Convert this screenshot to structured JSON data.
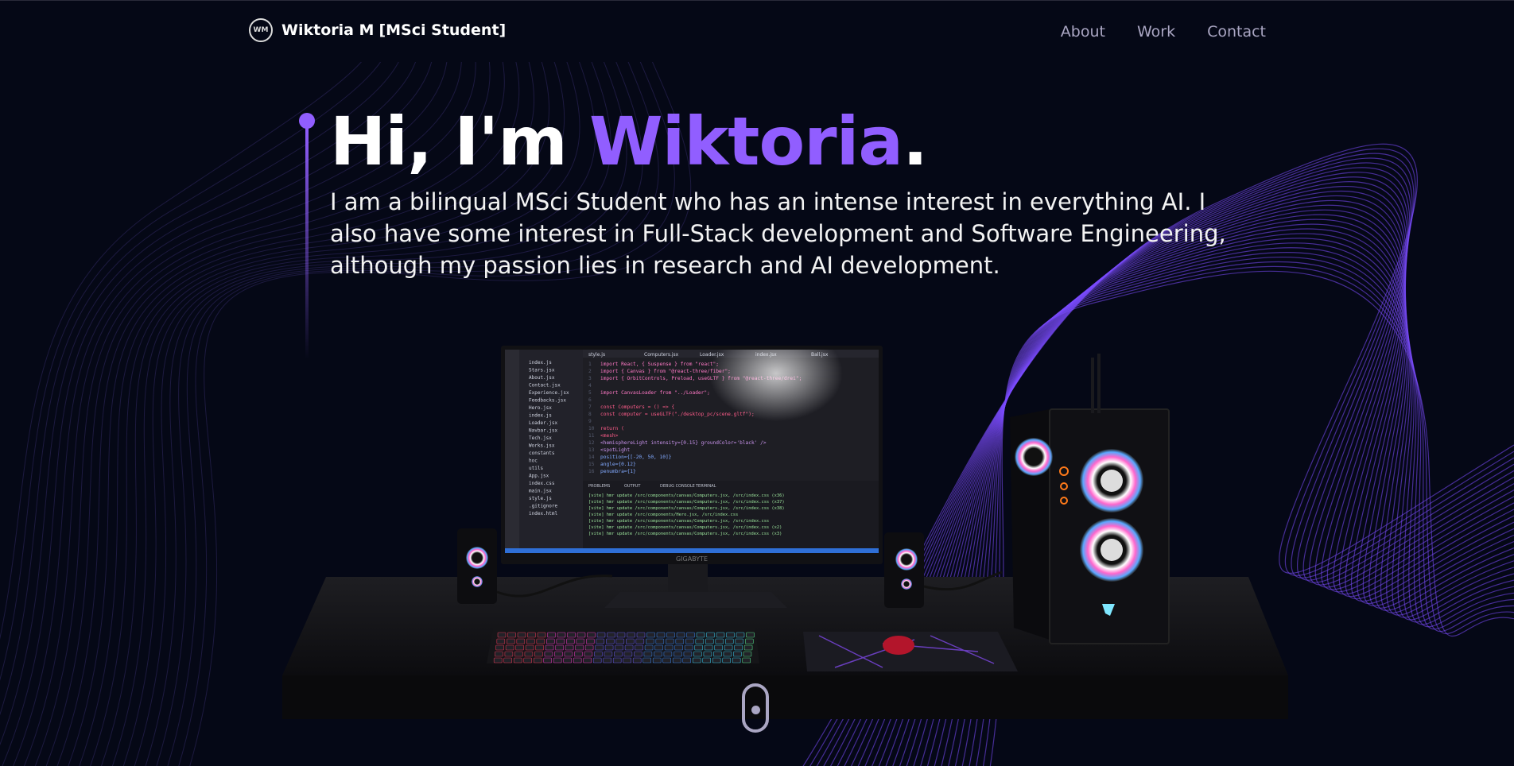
{
  "nav": {
    "logo_text": "WM",
    "brand_name": "Wiktoria M",
    "brand_subtitle": "[MSci Student]",
    "links": [
      "About",
      "Work",
      "Contact"
    ]
  },
  "hero": {
    "greeting": "Hi, I'm ",
    "name": "Wiktoria",
    "period": ".",
    "intro": "I am a bilingual MSci Student who has an intense interest in everything AI. I also have some interest in Full-Stack development and Software Engineering, although my passion lies in research and AI development."
  },
  "scene": {
    "monitor_brand": "GIGABYTE",
    "code_lines": [
      "import React, { Suspense } from \"react\";",
      "import { Canvas } from \"@react-three/fiber\";",
      "import { OrbitControls, Preload, useGLTF } from \"@react-three/drei\";",
      "",
      "import CanvasLoader from \"../Loader\";",
      "",
      "const Computers = () => {",
      "  const computer = useGLTF(\"./desktop_pc/scene.gltf\");",
      "",
      "  return (",
      "    <mesh>",
      "      <hemisphereLight intensity={0.15} groundColor='black' />",
      "      <spotLight",
      "        position={[-20, 50, 10]}",
      "        angle={0.12}",
      "        penumbra={1}"
    ],
    "tabs": [
      "style.js",
      "Computers.jsx",
      "Loader.jsx",
      "index.jsx",
      "Ball.jsx"
    ],
    "files": [
      "index.js",
      "Stars.jsx",
      "About.jsx",
      "Contact.jsx",
      "Experience.jsx",
      "Feedbacks.jsx",
      "Hero.jsx",
      "index.js",
      "Loader.jsx",
      "Navbar.jsx",
      "Tech.jsx",
      "Works.jsx",
      "constants",
      "hoc",
      "utils",
      "App.jsx",
      "index.css",
      "main.jsx",
      "style.js",
      ".gitignore",
      "index.html"
    ],
    "terminal_lines": [
      "[vite] hmr update /src/components/canvas/Computers.jsx, /src/index.css (x36)",
      "[vite] hmr update /src/components/canvas/Computers.jsx, /src/index.css (x37)",
      "[vite] hmr update /src/components/canvas/Computers.jsx, /src/index.css (x38)",
      "[vite] hmr update /src/components/Hero.jsx, /src/index.css",
      "[vite] hmr update /src/components/canvas/Computers.jsx, /src/index.css",
      "[vite] hmr update /src/components/canvas/Computers.jsx, /src/index.css (x2)",
      "[vite] hmr update /src/components/canvas/Computers.jsx, /src/index.css (x3)"
    ],
    "panel_tabs": [
      "PROBLEMS",
      "OUTPUT",
      "DEBUG CONSOLE",
      "TERMINAL"
    ]
  },
  "colors": {
    "background": "#050816",
    "accent": "#915eff",
    "secondary": "#aaa6c3"
  }
}
